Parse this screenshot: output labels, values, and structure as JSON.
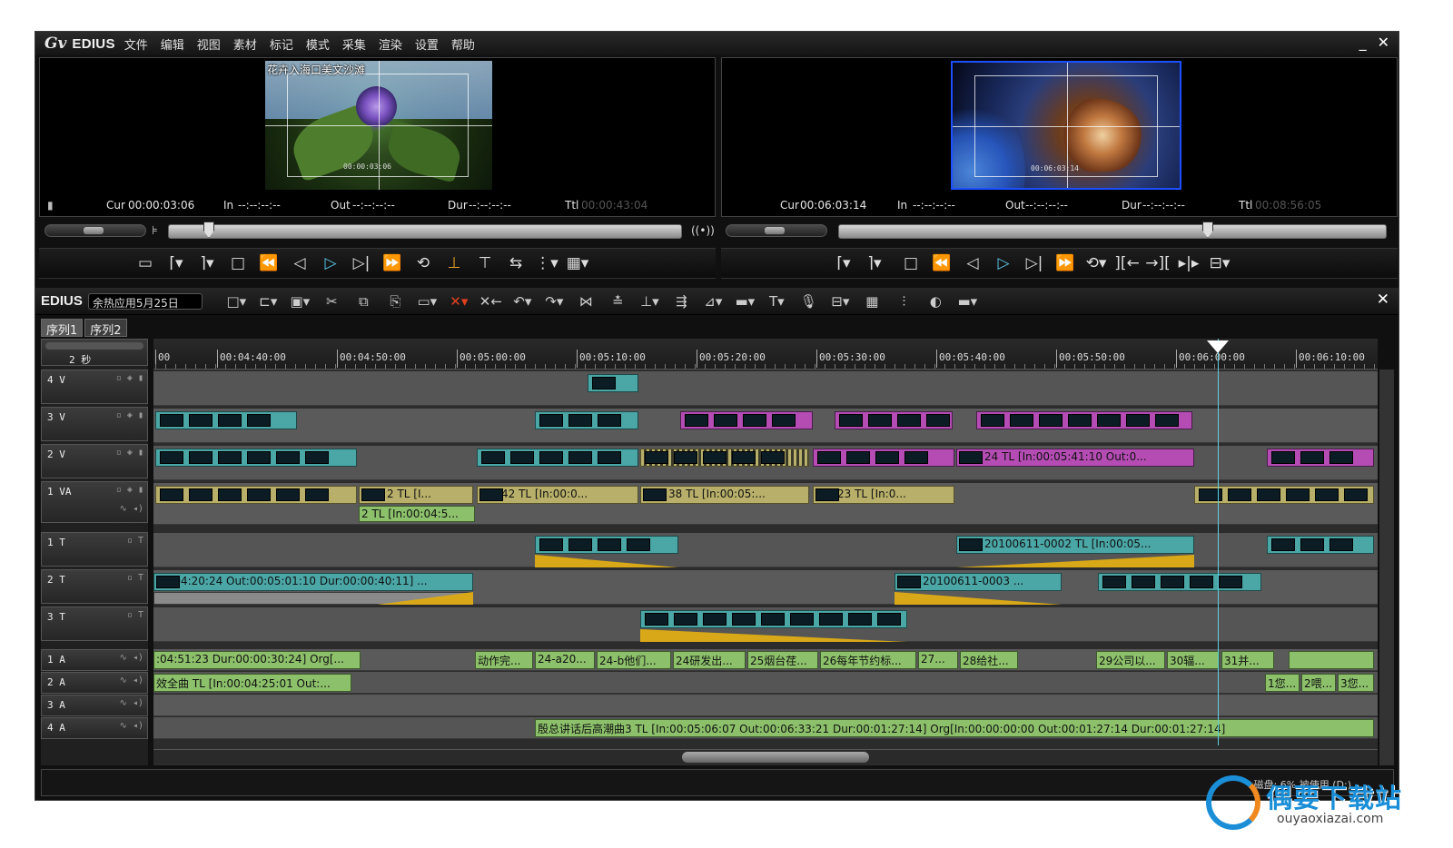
{
  "app": {
    "logo": "EDIUS",
    "menu": [
      "文件",
      "编辑",
      "视图",
      "素材",
      "标记",
      "模式",
      "采集",
      "渲染",
      "设置",
      "帮助"
    ],
    "minimize": "_",
    "close": "✕"
  },
  "player": {
    "caption": "花卉入海口美文沙滩",
    "cur_label": "Cur",
    "cur": "00:00:03:06",
    "in_label": "In",
    "in": "--:--:--:--",
    "out_label": "Out",
    "out": "--:--:--:--",
    "dur_label": "Dur",
    "dur": "--:--:--:--",
    "ttl_label": "Ttl",
    "ttl": "00:00:43:04"
  },
  "recorder": {
    "cur_label": "Cur",
    "cur": "00:06:03:14",
    "in_label": "In",
    "in": "--:--:--:--",
    "out_label": "Out",
    "out": "--:--:--:--",
    "dur_label": "Dur",
    "dur": "--:--:--:--",
    "ttl_label": "Ttl",
    "ttl": "00:08:56:05"
  },
  "timeline": {
    "brand": "EDIUS",
    "project": "余热应用5月25日",
    "sequences": [
      "序列1",
      "序列2"
    ],
    "zoom": "2 秒",
    "ruler": [
      "00",
      "00:04:40:00",
      "00:04:50:00",
      "00:05:00:00",
      "00:05:10:00",
      "00:05:20:00",
      "00:05:30:00",
      "00:05:40:00",
      "00:05:50:00",
      "00:06:00:00",
      "00:06:10:00"
    ],
    "tracks": {
      "v4": "4 V",
      "v3": "3 V",
      "v2": "2 V",
      "va1": "1 VA",
      "t1": "1 T",
      "t2": "2 T",
      "t3": "3 T",
      "a1": "1 A",
      "a2": "2 A",
      "a3": "3 A",
      "a4": "4 A"
    },
    "clips": {
      "v2_24": "24  TL [In:00:05:41:10 Out:0...",
      "va_2": "2  TL [I...",
      "va_42": "42  TL [In:00:0...",
      "va_38": "38  TL [In:00:05:...",
      "va_23": "23  TL [In:0...",
      "va_audio2": "2  TL [In:00:04:5...",
      "t1_clip": "20100611-0002  TL [In:00:05...",
      "t2_clip1": "00:04:20:24 Out:00:05:01:10 Dur:00:00:40:11]  ...",
      "t2_clip2": "20100611-0003  ...",
      "a1_c1": ":04:51:23 Dur:00:00:30:24]  Org[...",
      "a1_c2": "动作完...",
      "a1_c3": "24-a20...",
      "a1_c4": "24-b他们...",
      "a1_c5": "24研发出...",
      "a1_c6": "25烟台荏...",
      "a1_c7": "26每年节约标...",
      "a1_c8": "27...",
      "a1_c9": "28给社...",
      "a1_c10": "29公司以...",
      "a1_c11": "30辐...",
      "a1_c12": "31并...",
      "a2_c1": "效全曲  TL [In:00:04:25:01 Out:...",
      "a2_c2": "1您...",
      "a2_c3": "2喂...",
      "a2_c4": "3您...",
      "a4_c1": "殷总讲话后高潮曲3  TL [In:00:05:06:07 Out:00:06:33:21 Dur:00:01:27:14]  Org[In:00:00:00:00 Out:00:01:27:14 Dur:00:01:27:14]"
    }
  },
  "status": "磁盘: 6% 被使用 (D:)",
  "watermark": {
    "title": "偶要下载站",
    "url": "ouyaoxiazai.com"
  },
  "colors": {
    "video_clip": "#4ba6a6",
    "title_clip": "#4ba6a6",
    "audio_clip": "#8cc06a",
    "playhead": "#5fd0e0"
  }
}
